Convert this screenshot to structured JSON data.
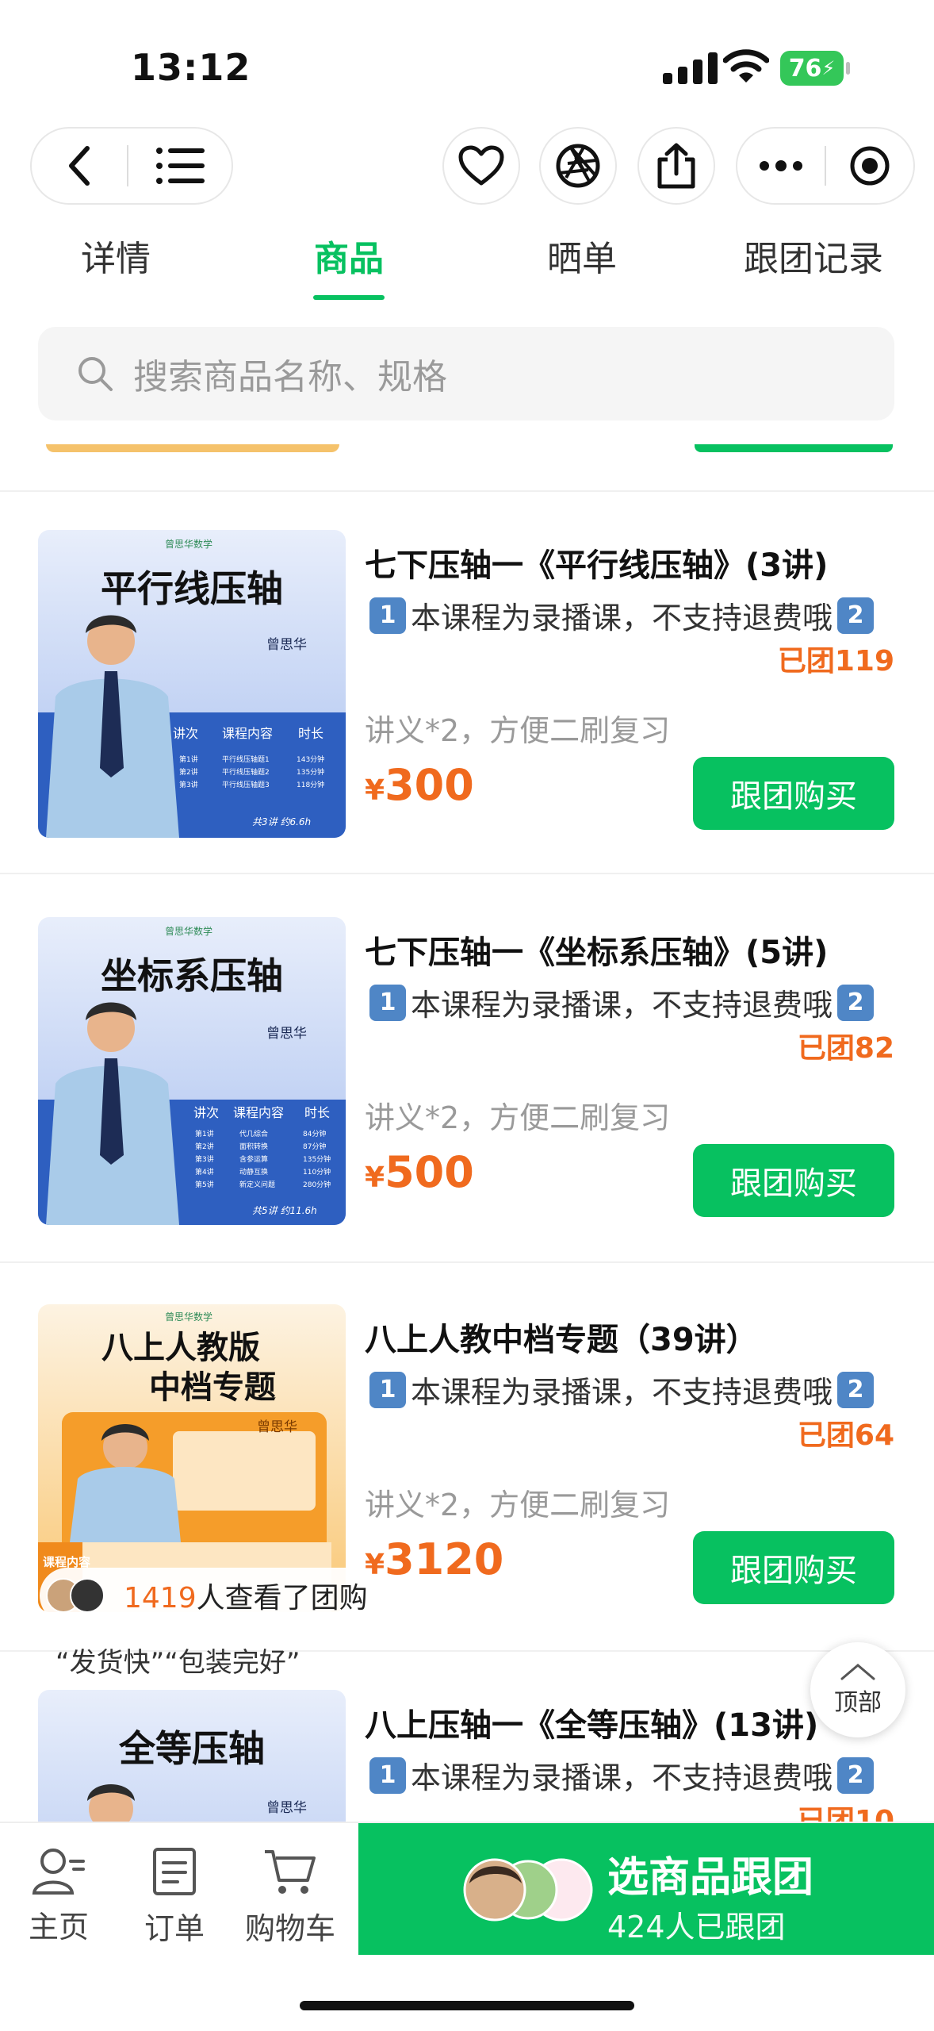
{
  "status_bar": {
    "time": "13:12",
    "battery": "76"
  },
  "tabs": [
    {
      "label": "详情"
    },
    {
      "label": "商品"
    },
    {
      "label": "晒单"
    },
    {
      "label": "跟团记录"
    }
  ],
  "active_tab": "商品",
  "search": {
    "placeholder": "搜索商品名称、规格"
  },
  "icons": {
    "back": "chevron-left-icon",
    "menu": "list-icon",
    "favorite": "heart-icon",
    "share_moments": "aperture-icon",
    "share": "share-icon",
    "more": "more-icon",
    "record": "record-icon"
  },
  "colors": {
    "accent": "#07c160",
    "price": "#f06a1e",
    "badge": "#4f86c6"
  },
  "products": [
    {
      "title": "七下压轴一《平行线压轴》(3讲)",
      "desc": "本课程为录播课，不支持退费哦",
      "badge1": "1",
      "badge2": "2",
      "group_count": "已团119",
      "note": "讲义*2，方便二刷复习",
      "currency": "¥",
      "price": "300",
      "button": "跟团购买",
      "thumb": {
        "brand": "曾思华数学",
        "heading": "平行线压轴",
        "teacher": "曾思华",
        "headers": [
          "讲次",
          "课程内容",
          "时长"
        ],
        "rows": [
          [
            "第1讲",
            "平行线压轴题1",
            "143分钟"
          ],
          [
            "第2讲",
            "平行线压轴题2",
            "135分钟"
          ],
          [
            "第3讲",
            "平行线压轴题3",
            "118分钟"
          ]
        ],
        "footer": "共3讲 约6.6h"
      }
    },
    {
      "title": "七下压轴一《坐标系压轴》(5讲)",
      "desc": "本课程为录播课，不支持退费哦",
      "badge1": "1",
      "badge2": "2",
      "group_count": "已团82",
      "note": "讲义*2，方便二刷复习",
      "currency": "¥",
      "price": "500",
      "button": "跟团购买",
      "thumb": {
        "brand": "曾思华数学",
        "heading": "坐标系压轴",
        "teacher": "曾思华",
        "headers": [
          "讲次",
          "课程内容",
          "时长"
        ],
        "rows": [
          [
            "第1讲",
            "代几综合",
            "84分钟"
          ],
          [
            "第2讲",
            "面积转换",
            "87分钟"
          ],
          [
            "第3讲",
            "含参运算",
            "135分钟"
          ],
          [
            "第4讲",
            "动静互换",
            "110分钟"
          ],
          [
            "第5讲",
            "新定义问题",
            "280分钟"
          ]
        ],
        "footer": "共5讲 约11.6h"
      }
    },
    {
      "title": "八上人教中档专题（39讲）",
      "desc": "本课程为录播课，不支持退费哦",
      "badge1": "1",
      "badge2": "2",
      "group_count": "已团64",
      "note": "讲义*2，方便二刷复习",
      "currency": "¥",
      "price": "3120",
      "button": "跟团购买",
      "thumb": {
        "brand": "曾思华数学",
        "heading1": "八上人教版",
        "heading2": "中档专题",
        "teacher": "曾思华",
        "side_label": "课程内容"
      }
    },
    {
      "title": "八上压轴一《全等压轴》(13讲)",
      "desc": "本课程为录播课，不支持退费哦",
      "badge1": "1",
      "badge2": "2",
      "group_count": "已团10",
      "thumb": {
        "heading": "全等压轴",
        "teacher": "曾思华"
      }
    }
  ],
  "viewers": {
    "count": "1419",
    "text": "人查看了团购"
  },
  "review_quote": "“发货快”“包装完好”",
  "to_top": "顶部",
  "bottom_nav": [
    {
      "label": "主页",
      "icon": "user-icon"
    },
    {
      "label": "订单",
      "icon": "order-icon"
    },
    {
      "label": "购物车",
      "icon": "cart-icon"
    }
  ],
  "cta": {
    "title": "选商品跟团",
    "subtitle": "424人已跟团"
  }
}
